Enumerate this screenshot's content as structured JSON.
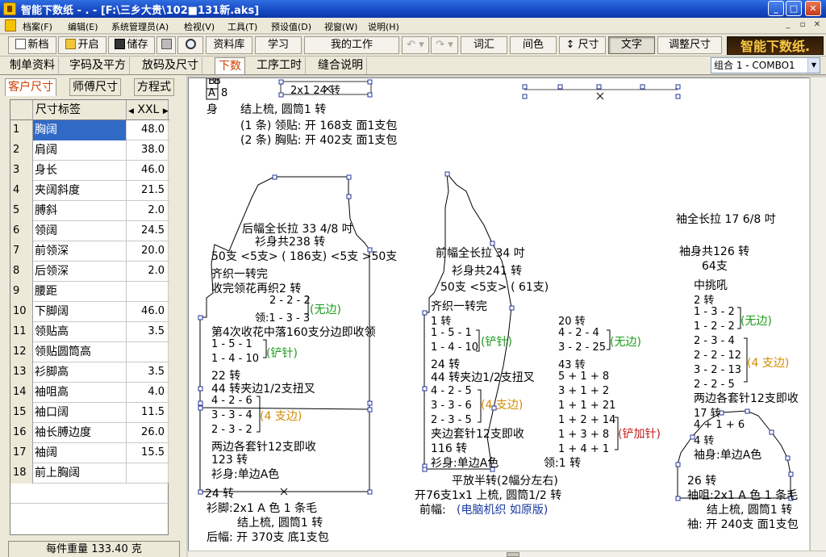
{
  "window": {
    "title": "智能下数纸 - . - [F:\\三乡大贵\\102■131新.aks]",
    "buttons": {
      "minimize": "_",
      "maximize": "□",
      "close": "✕"
    }
  },
  "menu": {
    "items": [
      "档案(F)",
      "编辑(E)",
      "系统管理员(A)",
      "检视(V)",
      "工具(T)",
      "预设值(D)",
      "视窗(W)",
      "说明(H)"
    ],
    "mdi": [
      "_",
      "▫",
      "✕"
    ]
  },
  "toolbar": {
    "new": "新档",
    "open": "开启",
    "save": "储存",
    "library": "资料库",
    "learn": "学习",
    "my_work": "我的工作",
    "undo": "↶ ▾",
    "redo": "↷ ▾",
    "vocab": "词汇",
    "color": "间色",
    "size": "尺寸",
    "text": "文字",
    "adjust_size": "调整尺寸",
    "brand": "智能下数纸."
  },
  "tabs": [
    "制单资料",
    "字码及平方",
    "放码及尺寸",
    "下数",
    "工序工时",
    "缝合说明"
  ],
  "combo": {
    "value": "组合 1 - COMBO1"
  },
  "left": {
    "subtabs": [
      "客户尺寸",
      "师傅尺寸",
      "方程式"
    ],
    "grid": {
      "header_label": "尺寸标签",
      "header_size": "XXL",
      "rows": [
        {
          "n": "1",
          "label": "胸阔",
          "value": "48.0"
        },
        {
          "n": "2",
          "label": "肩阔",
          "value": "38.0"
        },
        {
          "n": "3",
          "label": "身长",
          "value": "46.0"
        },
        {
          "n": "4",
          "label": "夹阔斜度",
          "value": "21.5"
        },
        {
          "n": "5",
          "label": "膊斜",
          "value": "2.0"
        },
        {
          "n": "6",
          "label": "领阔",
          "value": "24.5"
        },
        {
          "n": "7",
          "label": "前领深",
          "value": "20.0"
        },
        {
          "n": "8",
          "label": "后领深",
          "value": "2.0"
        },
        {
          "n": "9",
          "label": "腰距",
          "value": ""
        },
        {
          "n": "10",
          "label": "下脚阔",
          "value": "46.0"
        },
        {
          "n": "11",
          "label": "领贴高",
          "value": "3.5"
        },
        {
          "n": "12",
          "label": "领贴圆筒高",
          "value": ""
        },
        {
          "n": "13",
          "label": "衫脚高",
          "value": "3.5"
        },
        {
          "n": "14",
          "label": "袖咀高",
          "value": "4.0"
        },
        {
          "n": "15",
          "label": "袖口阔",
          "value": "11.5"
        },
        {
          "n": "16",
          "label": "袖长膊边度",
          "value": "26.0"
        },
        {
          "n": "17",
          "label": "袖阔",
          "value": "15.5"
        },
        {
          "n": "18",
          "label": "前上胸阔",
          "value": ""
        }
      ]
    },
    "footer": "每件重量 133.40 克"
  },
  "canvas": {
    "top": {
      "mini_b1": "B",
      "mini_b2": "B",
      "mini_a": "A",
      "mini_8": "8",
      "box_text": "2x1  24 转",
      "shen": "身",
      "line1": "结上梳, 圆筒1 转",
      "line2": "(1 条) 领贴: 开 168支 面1支包",
      "line3": "(2 条) 胸贴: 开 402支 面1支包"
    },
    "back": {
      "title": "后幅全长拉 33 4/8 吋",
      "total": "衫身共238 转",
      "needles": "50支 <5支> ( 186支) <5支 >50支",
      "l1": "齐织一转完",
      "l2": "收完领花再织2 转",
      "n1": "2 - 2 - 2",
      "n2": "领:1 - 3 - 3",
      "n_tag": "(无边)",
      "l3": "第4次收花中落160支分边即收领",
      "a1": "1 - 5 - 1",
      "a2": "1 - 4 - 10",
      "a_tag": "(铲针)",
      "l4": "22 转",
      "l5": "44 转夹边1/2支扭叉",
      "b1": "4 - 2 - 6",
      "b2": "3 - 3 - 4",
      "b3": "2 - 3 - 2",
      "b_tag": "(4 支边)",
      "l6": "两边各套针12支即收",
      "l7": "123 转",
      "l8": "衫身:单边A色",
      "l9": "24 转",
      "l10": "衫脚:2x1   A 色 1 条毛",
      "l11": "结上梳, 圆筒1 转",
      "l12": "后幅: 开 370支 底1支包"
    },
    "front": {
      "title": "前幅全长拉 34 吋",
      "total": "衫身共241 转",
      "needles": "50支 <5支> ( 61支)",
      "l1": "齐织一转完",
      "l2": "1 转",
      "a1": "1 - 5 - 1",
      "a2": "1 - 4 - 10",
      "a_tag": "(铲针)",
      "l3": "24 转",
      "l4": "44 转夹边1/2支扭叉",
      "b1": "4 - 2 - 5",
      "b2": "3 - 3 - 6",
      "b3": "2 - 3 - 5",
      "b_tag": "(4 支边)",
      "l5": "夹边套针12支即收",
      "l6": "116 转",
      "l7": "衫身:单边A色",
      "l8": "平放半转(2幅分左右)",
      "l9": "开76支1x1 上梳, 圆筒1/2 转",
      "l10_label": "前幅:",
      "l10_val": "(电脑机织 如原版)"
    },
    "neck": {
      "c1": "20 转",
      "c2": "4 - 2 - 4",
      "c3": "3 - 2 - 25",
      "c_tag": "(无边)",
      "c4": "43 转",
      "d1": "5 + 1 + 8",
      "d2": "3 + 1 + 2",
      "d3": "1 + 1 + 21",
      "d4": "1 + 2 + 14",
      "d5": "1 + 3 + 8",
      "d6": "1 + 4 + 1",
      "d_tag": "(铲加针)",
      "d7": "领:1 转"
    },
    "sleeve": {
      "title": "袖全长拉 17 6/8 吋",
      "total": "袖身共126 转",
      "needles": "64支",
      "mid": "中挑吼",
      "l1": "2 转",
      "a1": "1 - 3 - 2",
      "a2": "1 - 2 - 2",
      "a_tag": "(无边)",
      "b1": "2 - 3 - 4",
      "b2": "2 - 2 - 12",
      "b3": "3 - 2 - 13",
      "b4": "2 - 2 - 5",
      "b_tag": "(4 支边)",
      "l2": "两边各套针12支即收",
      "l3": "17 转",
      "l4": "4 + 1 + 6",
      "l5": "4 转",
      "l6": "袖身:单边A色",
      "l7": "26 转",
      "l8": "袖咀:2x1   A 色 1 条毛",
      "l9": "结上梳, 圆筒1 转",
      "l10": "袖: 开 240支 面1支包"
    }
  }
}
